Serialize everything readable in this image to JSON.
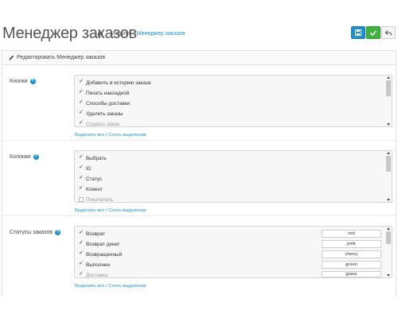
{
  "header": {
    "title": "Менеджер заказов",
    "breadcrumbs": [
      {
        "label": "Модули"
      },
      {
        "label": "Менеджер заказов"
      }
    ],
    "buttons": {
      "save_icon": "save-icon",
      "apply_icon": "check-icon",
      "back_icon": "reply-icon"
    }
  },
  "panel": {
    "title": "Редактировать Менеджер заказов",
    "icon": "pencil-icon"
  },
  "sections": {
    "buttons": {
      "label": "Кнопки",
      "items": [
        {
          "label": "Добавить в историю заказа",
          "checked": true
        },
        {
          "label": "Печать накладной",
          "checked": true
        },
        {
          "label": "Способы доставки",
          "checked": true
        },
        {
          "label": "Удалить заказы",
          "checked": true
        },
        {
          "label": "Создать заказ",
          "checked": true
        }
      ],
      "select_all": "Выделить все",
      "deselect": "Снять выделение"
    },
    "columns": {
      "label": "Колонки",
      "items": [
        {
          "label": "Выбрать",
          "checked": true
        },
        {
          "label": "ID",
          "checked": true
        },
        {
          "label": "Статус",
          "checked": true
        },
        {
          "label": "Клиент",
          "checked": true
        },
        {
          "label": "Покупатель",
          "checked": false
        }
      ],
      "select_all": "Выделить все",
      "deselect": "Снять выделение"
    },
    "statuses": {
      "label": "Статусы заказов",
      "items": [
        {
          "label": "Возврат",
          "checked": true,
          "color": "red"
        },
        {
          "label": "Возврат денег",
          "checked": true,
          "color": "pink"
        },
        {
          "label": "Возвращенный",
          "checked": true,
          "color": "cherry"
        },
        {
          "label": "Выполнен",
          "checked": true,
          "color": "green"
        },
        {
          "label": "Доставка",
          "checked": true,
          "color": "grass"
        }
      ],
      "select_all": "Выделить все",
      "deselect": "Снять выделение"
    }
  },
  "colors": {
    "primary": "#1e91cf",
    "success": "#3fb33f"
  }
}
